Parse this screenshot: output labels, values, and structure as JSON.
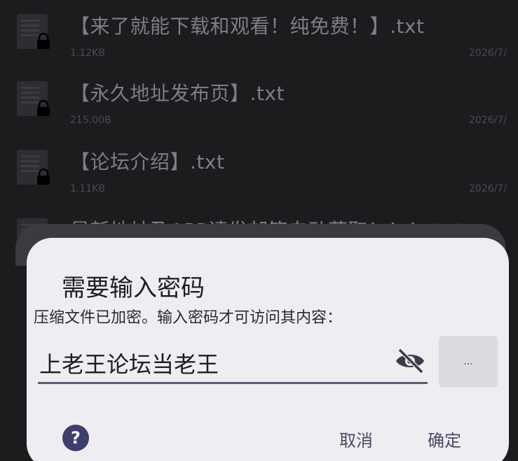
{
  "files": [
    {
      "name": "【来了就能下载和观看！纯免费！】.txt",
      "size": "1.12KB",
      "date": "2026/7/"
    },
    {
      "name": "【永久地址发布页】.txt",
      "size": "215.00B",
      "date": "2026/7/"
    },
    {
      "name": "【论坛介绍】.txt",
      "size": "1.11KB",
      "date": "2026/7/"
    },
    {
      "name": "最新地址及APP请发邮箱自动获取！！！.txt",
      "size": "",
      "date": ""
    }
  ],
  "dialog": {
    "title": "需要输入密码",
    "message": "压缩文件已加密。输入密码才可访问其内容：",
    "password_value": "上老王论坛当老王",
    "more_label": "...",
    "cancel_label": "取消",
    "ok_label": "确定"
  },
  "colors": {
    "accent": "#4b4a63",
    "help_icon": "#3f3c6e",
    "dialog_bg": "#eeedf1",
    "backdrop": "#1c1c1f"
  },
  "icons": {
    "file": "archive-file-icon",
    "lock": "lock-icon",
    "visibility": "eye-off-icon",
    "help": "question-circle-icon"
  }
}
